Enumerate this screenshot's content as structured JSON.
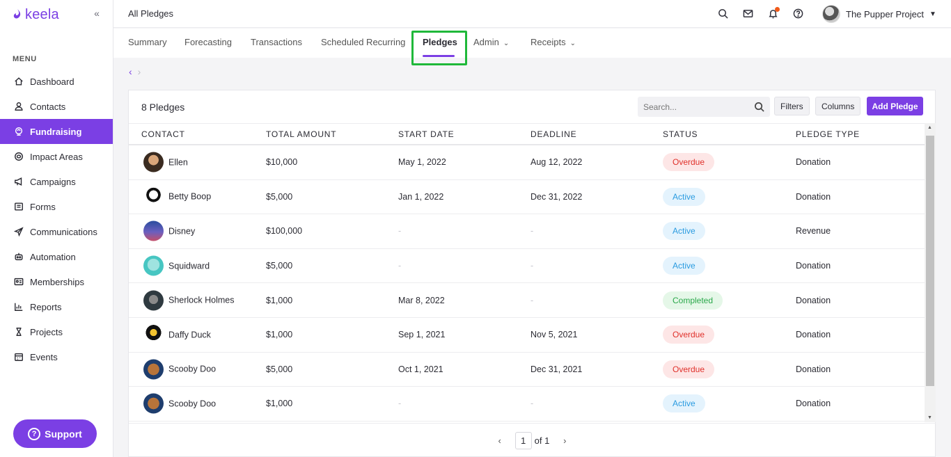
{
  "brand": {
    "name": "keela",
    "color": "#7b3fe4"
  },
  "sidebar": {
    "menu_label": "MENU",
    "items": [
      {
        "label": "Dashboard",
        "icon": "home-icon",
        "active": false
      },
      {
        "label": "Contacts",
        "icon": "person-icon",
        "active": false
      },
      {
        "label": "Fundraising",
        "icon": "donation-icon",
        "active": true
      },
      {
        "label": "Impact Areas",
        "icon": "impact-icon",
        "active": false
      },
      {
        "label": "Campaigns",
        "icon": "megaphone-icon",
        "active": false
      },
      {
        "label": "Forms",
        "icon": "form-icon",
        "active": false
      },
      {
        "label": "Communications",
        "icon": "send-icon",
        "active": false
      },
      {
        "label": "Automation",
        "icon": "robot-icon",
        "active": false
      },
      {
        "label": "Memberships",
        "icon": "id-card-icon",
        "active": false
      },
      {
        "label": "Reports",
        "icon": "chart-icon",
        "active": false
      },
      {
        "label": "Projects",
        "icon": "hourglass-icon",
        "active": false
      },
      {
        "label": "Events",
        "icon": "calendar-icon",
        "active": false
      }
    ],
    "support_label": "Support"
  },
  "topbar": {
    "title": "All Pledges",
    "org_name": "The Pupper Project"
  },
  "tabs": [
    {
      "label": "Summary"
    },
    {
      "label": "Forecasting"
    },
    {
      "label": "Transactions"
    },
    {
      "label": "Scheduled Recurring"
    },
    {
      "label": "Pledges",
      "active": true
    },
    {
      "label": "Admin",
      "dropdown": true
    },
    {
      "label": "Receipts",
      "dropdown": true
    }
  ],
  "card": {
    "title": "8 Pledges",
    "search_placeholder": "Search...",
    "filters_label": "Filters",
    "columns_label": "Columns",
    "add_label": "Add Pledge"
  },
  "table": {
    "headers": [
      "Contact",
      "Total Amount",
      "Start Date",
      "Deadline",
      "Status",
      "Pledge Type"
    ],
    "rows": [
      {
        "contact": "Ellen",
        "amount": "$10,000",
        "start": "May 1, 2022",
        "deadline": "Aug 12, 2022",
        "status": "Overdue",
        "type": "Donation"
      },
      {
        "contact": "Betty Boop",
        "amount": "$5,000",
        "start": "Jan 1, 2022",
        "deadline": "Dec 31, 2022",
        "status": "Active",
        "type": "Donation"
      },
      {
        "contact": "Disney",
        "amount": "$100,000",
        "start": "-",
        "deadline": "-",
        "status": "Active",
        "type": "Revenue"
      },
      {
        "contact": "Squidward",
        "amount": "$5,000",
        "start": "-",
        "deadline": "-",
        "status": "Active",
        "type": "Donation"
      },
      {
        "contact": "Sherlock Holmes",
        "amount": "$1,000",
        "start": "Mar 8, 2022",
        "deadline": "-",
        "status": "Completed",
        "type": "Donation"
      },
      {
        "contact": "Daffy Duck",
        "amount": "$1,000",
        "start": "Sep 1, 2021",
        "deadline": "Nov 5, 2021",
        "status": "Overdue",
        "type": "Donation"
      },
      {
        "contact": "Scooby Doo",
        "amount": "$5,000",
        "start": "Oct 1, 2021",
        "deadline": "Dec 31, 2021",
        "status": "Overdue",
        "type": "Donation"
      },
      {
        "contact": "Scooby Doo",
        "amount": "$1,000",
        "start": "-",
        "deadline": "-",
        "status": "Active",
        "type": "Donation"
      }
    ]
  },
  "pagination": {
    "current": "1",
    "of_label": "of 1"
  },
  "colors": {
    "accent": "#7b3fe4",
    "overdue": "#e0302a",
    "active": "#2a9be0",
    "completed": "#2aa84a",
    "highlight": "#1fb83a"
  }
}
